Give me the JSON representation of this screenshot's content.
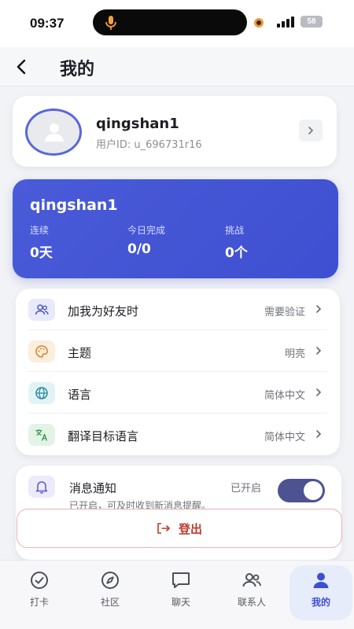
{
  "status_bar": {
    "time": "09:37",
    "battery": "58"
  },
  "header": {
    "title": "我的"
  },
  "profile": {
    "name": "qingshan1",
    "user_id": "用户ID: u_696731r16"
  },
  "stats": {
    "name": "qingshan1",
    "items": [
      {
        "label": "连续",
        "value": "0天"
      },
      {
        "label": "今日完成",
        "value": "0/0"
      },
      {
        "label": "挑战",
        "value": "0个"
      }
    ]
  },
  "settings": {
    "items": [
      {
        "label": "加我为好友时",
        "value": "需要验证",
        "icon": "users-icon",
        "icon_bg": "#e8e9fb",
        "icon_color": "#4a55c9"
      },
      {
        "label": "主题",
        "value": "明亮",
        "icon": "palette-icon",
        "icon_bg": "#fbeedd",
        "icon_color": "#d9822b"
      },
      {
        "label": "语言",
        "value": "简体中文",
        "icon": "globe-icon",
        "icon_bg": "#e2f2f5",
        "icon_color": "#2b8aa0"
      },
      {
        "label": "翻译目标语言",
        "value": "简体中文",
        "icon": "translate-icon",
        "icon_bg": "#e3f3e6",
        "icon_color": "#3a9a55"
      }
    ]
  },
  "notifications": {
    "title": "消息通知",
    "status": "已开启",
    "description": "已开启，可及时收到新消息提醒。",
    "enabled": true
  },
  "logout": {
    "label": "登出"
  },
  "tabbar": {
    "tabs": [
      {
        "label": "打卡",
        "icon": "check-circle-icon",
        "active": false
      },
      {
        "label": "社区",
        "icon": "compass-icon",
        "active": false
      },
      {
        "label": "聊天",
        "icon": "chat-icon",
        "active": false
      },
      {
        "label": "联系人",
        "icon": "contacts-icon",
        "active": false
      },
      {
        "label": "我的",
        "icon": "person-icon",
        "active": true
      }
    ]
  },
  "colors": {
    "accent": "#3e4fd1",
    "danger": "#c0392b",
    "toggle": "#4d5290"
  }
}
